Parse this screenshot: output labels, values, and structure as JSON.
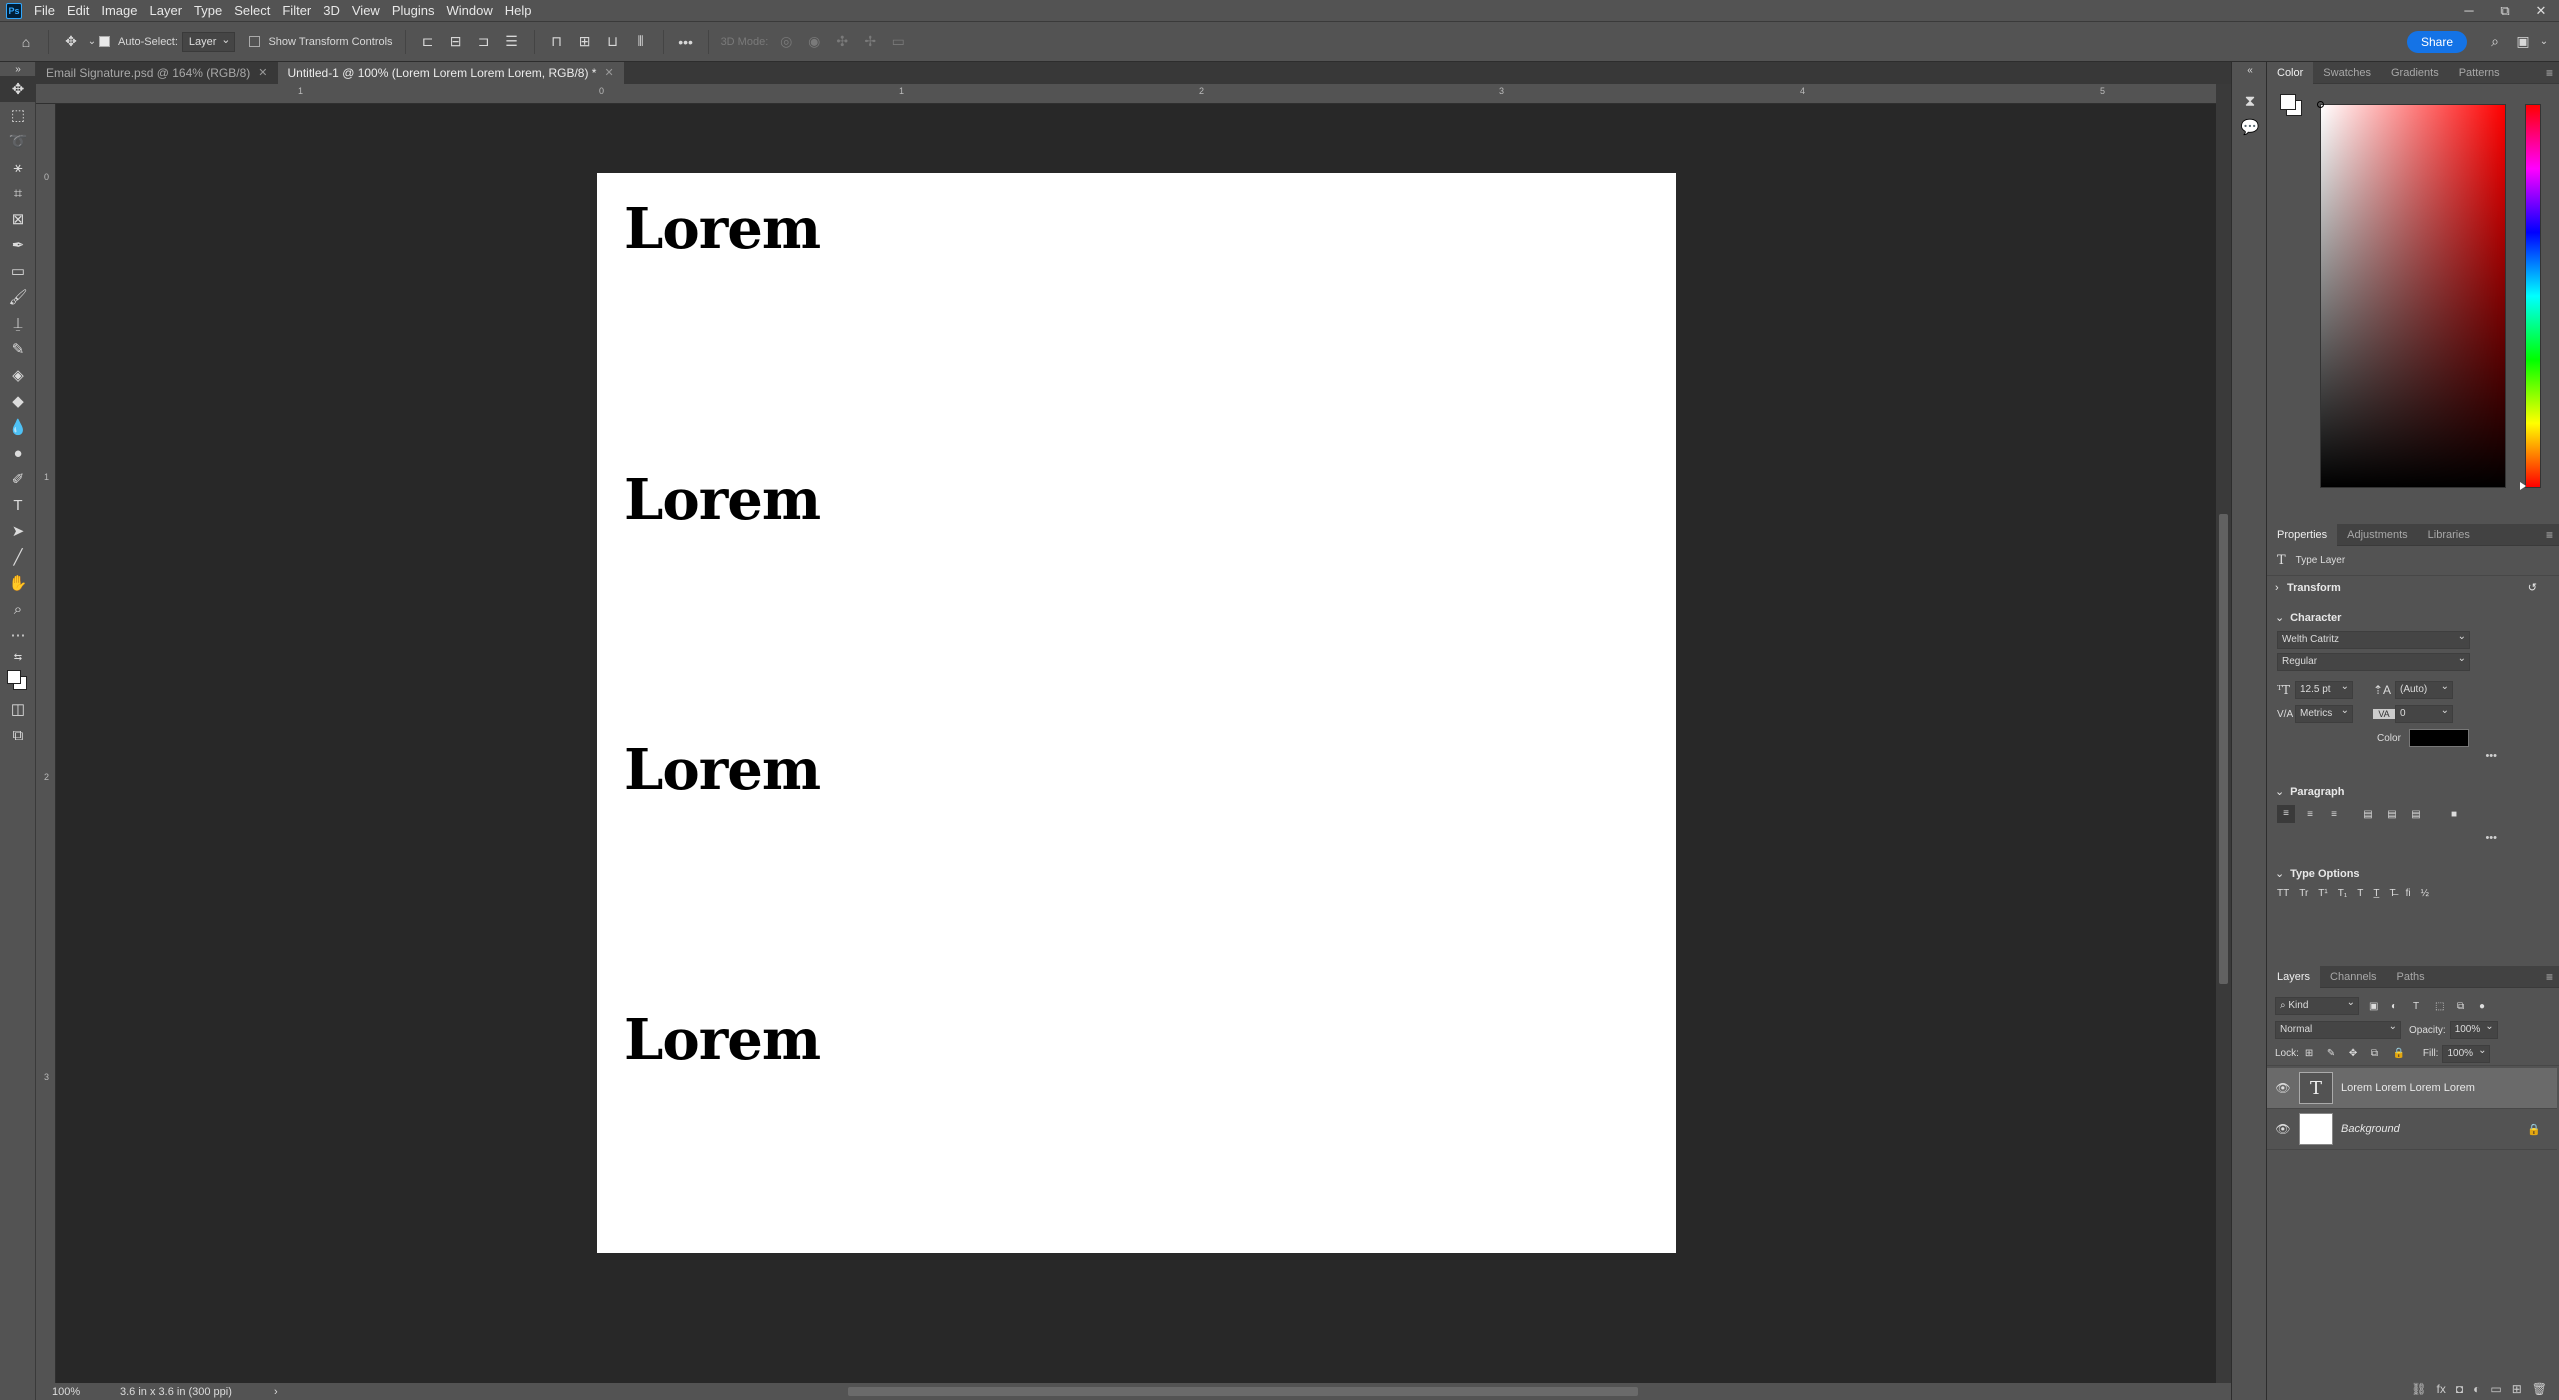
{
  "app": {
    "logo": "Ps"
  },
  "menu": [
    "File",
    "Edit",
    "Image",
    "Layer",
    "Type",
    "Select",
    "Filter",
    "3D",
    "View",
    "Plugins",
    "Window",
    "Help"
  ],
  "window_controls": [
    "─",
    "⧉",
    "✕"
  ],
  "options": {
    "auto_select_label": "Auto-Select:",
    "auto_select_target": "Layer",
    "show_transform_label": "Show Transform Controls",
    "mode_3d_label": "3D Mode:",
    "more": "•••",
    "share_label": "Share"
  },
  "tabs": [
    {
      "label": "Email Signature.psd @ 164% (RGB/8)",
      "active": false
    },
    {
      "label": "Untitled-1 @ 100% (Lorem Lorem Lorem Lorem, RGB/8) *",
      "active": true
    }
  ],
  "ruler_top": [
    "1",
    "0",
    "1",
    "2",
    "3",
    "4",
    "5"
  ],
  "ruler_left": [
    "0",
    "1",
    "2",
    "3"
  ],
  "canvas": {
    "lines": [
      "Lorem",
      "Lorem",
      "Lorem",
      "Lorem"
    ]
  },
  "status": {
    "zoom": "100%",
    "doc_size": "3.6 in x 3.6 in (300 ppi)",
    "arrow": "›"
  },
  "color_panel": {
    "tabs": [
      {
        "label": "Color",
        "active": true
      },
      {
        "label": "Swatches",
        "active": false
      },
      {
        "label": "Gradients",
        "active": false
      },
      {
        "label": "Patterns",
        "active": false
      }
    ],
    "hue_color": "#ff0000"
  },
  "properties_panel": {
    "tabs": [
      {
        "label": "Properties",
        "active": true
      },
      {
        "label": "Adjustments",
        "active": false
      },
      {
        "label": "Libraries",
        "active": false
      }
    ],
    "layer_kind": "Type Layer",
    "transform_label": "Transform",
    "character_label": "Character",
    "font_family": "Welth Catritz",
    "font_style": "Regular",
    "font_size": "12.5 pt",
    "leading": "(Auto)",
    "kerning": "Metrics",
    "tracking": "0",
    "color_label": "Color",
    "text_color": "#000000",
    "more": "•••",
    "paragraph_label": "Paragraph",
    "type_options_label": "Type Options"
  },
  "layers_panel": {
    "tabs": [
      {
        "label": "Layers",
        "active": true
      },
      {
        "label": "Channels",
        "active": false
      },
      {
        "label": "Paths",
        "active": false
      }
    ],
    "filter_kind": "Kind",
    "blend_mode": "Normal",
    "opacity_label": "Opacity:",
    "opacity": "100%",
    "lock_label": "Lock:",
    "fill_label": "Fill:",
    "fill": "100%",
    "layers": [
      {
        "name": "Lorem Lorem Lorem Lorem",
        "type": "text",
        "selected": true
      },
      {
        "name": "Background",
        "type": "pixel",
        "selected": false
      }
    ]
  }
}
